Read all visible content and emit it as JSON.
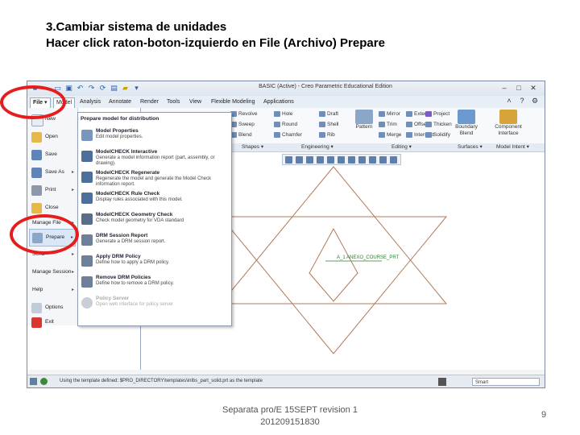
{
  "slide": {
    "title_line1": "3.Cambiar sistema de unidades",
    "title_line2": "Hacer click raton-boton-izquierdo en File (Archivo) Prepare",
    "footer_line1": "Separata pro/E 15SEPT revision 1",
    "footer_line2": "201209151830",
    "page_number": "9"
  },
  "app": {
    "title": "BASIC (Active) - Creo Parametric Educational Edition",
    "tabs": [
      "File",
      "Model",
      "Analysis",
      "Annotate",
      "Render",
      "Tools",
      "View",
      "Flexible Modeling",
      "Applications"
    ],
    "ribbon": {
      "col1": [
        "Revolve",
        "Sweep",
        "Blend"
      ],
      "col2": [
        "Hole",
        "Round",
        "Chamfer"
      ],
      "col3": [
        "Draft",
        "Shell",
        "Rib"
      ],
      "pattern": "Pattern",
      "col4": [
        "Mirror",
        "Trim",
        "Merge"
      ],
      "col5": [
        "Extend",
        "Offset",
        "Intersect"
      ],
      "col6": [
        "Project",
        "Thicken",
        "Solidify"
      ],
      "boundary": "Boundary Blend",
      "component": "Component Interface",
      "group_labels": [
        "Shapes",
        "Engineering",
        "Editing",
        "Surfaces",
        "Model Intent"
      ]
    },
    "file_menu": {
      "items": [
        {
          "label": "New",
          "arrow": ""
        },
        {
          "label": "Open",
          "arrow": ""
        },
        {
          "label": "Save",
          "arrow": ""
        },
        {
          "label": "Save As",
          "arrow": "▸"
        },
        {
          "label": "Print",
          "arrow": "▸"
        },
        {
          "label": "Close",
          "arrow": ""
        },
        {
          "label": "Manage File",
          "arrow": "▸"
        },
        {
          "label": "Prepare",
          "arrow": "▸"
        },
        {
          "label": "Send",
          "arrow": "▸"
        },
        {
          "label": "Manage Session",
          "arrow": "▸"
        },
        {
          "label": "Help",
          "arrow": "▸"
        },
        {
          "label": "Options",
          "arrow": ""
        },
        {
          "label": "Exit",
          "arrow": ""
        }
      ]
    },
    "prepare_submenu": {
      "header": "Prepare model for distribution",
      "items": [
        {
          "title": "Model Properties",
          "desc": "Edit model properties."
        },
        {
          "title": "ModelCHECK Interactive",
          "desc": "Generate a model information report (part, assembly, or drawing)."
        },
        {
          "title": "ModelCHECK Regenerate",
          "desc": "Regenerate the model and generate the Model Check information report."
        },
        {
          "title": "ModelCHECK Rule Check",
          "desc": "Display rules associated with this model."
        },
        {
          "title": "ModelCHECK Geometry Check",
          "desc": "Check model geometry for VDA standard"
        },
        {
          "title": "DRM Session Report",
          "desc": "Generate a DRM session report."
        },
        {
          "title": "Apply DRM Policy",
          "desc": "Define how to apply a DRM policy."
        },
        {
          "title": "Remove DRM Policies",
          "desc": "Define how to remove a DRM policy."
        },
        {
          "title": "Policy Server",
          "desc": "Open web interface for policy server"
        }
      ]
    },
    "datum_label": "A_1 ANEXO_COURSE_PRT",
    "status": "Using the template defined: $PRO_DIRECTORY\\templates\\inlbs_part_solid.prt as the template",
    "filter": "Smart"
  }
}
